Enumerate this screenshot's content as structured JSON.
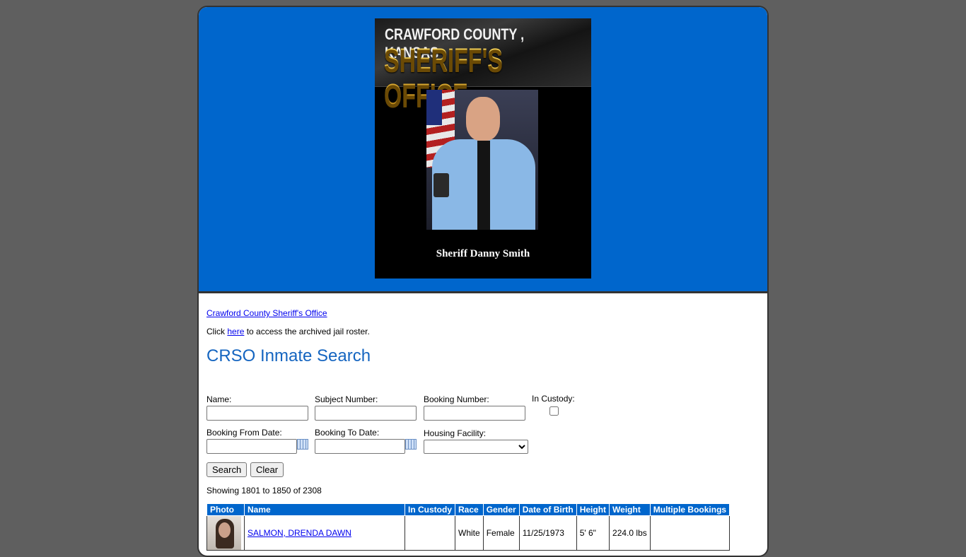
{
  "banner": {
    "county": "CRAWFORD COUNTY , KANSAS",
    "office": "SHERIFF'S OFFICE",
    "sheriff_name": "Sheriff Danny Smith"
  },
  "links": {
    "office_link": "Crawford County Sheriff's Office",
    "archive_prefix": "Click ",
    "archive_link": "here",
    "archive_suffix": " to access the archived jail roster."
  },
  "title": "CRSO Inmate Search",
  "form": {
    "name_label": "Name:",
    "name_value": "",
    "subject_label": "Subject Number:",
    "subject_value": "",
    "booking_label": "Booking Number:",
    "booking_value": "",
    "custody_label": "In Custody:",
    "from_label": "Booking From Date:",
    "from_value": "",
    "to_label": "Booking To Date:",
    "to_value": "",
    "facility_label": "Housing Facility:",
    "facility_value": "",
    "search_button": "Search",
    "clear_button": "Clear"
  },
  "showing": "Showing 1801 to 1850 of 2308",
  "table": {
    "headers": [
      "Photo",
      "Name",
      "In Custody",
      "Race",
      "Gender",
      "Date of Birth",
      "Height",
      "Weight",
      "Multiple Bookings"
    ],
    "rows": [
      {
        "name": "SALMON, DRENDA DAWN",
        "in_custody": "",
        "race": "White",
        "gender": "Female",
        "dob": "11/25/1973",
        "height": "5' 6\"",
        "weight": "224.0 lbs",
        "multiple_bookings": ""
      }
    ]
  },
  "colors": {
    "header_blue": "#0066cc",
    "title_blue": "#1565c0",
    "page_background": "#5f5f5f"
  }
}
